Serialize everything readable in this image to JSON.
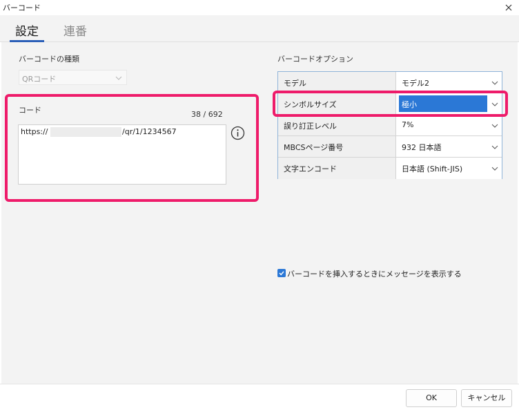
{
  "window": {
    "title": "バーコード"
  },
  "tabs": [
    {
      "label": "設定",
      "active": true
    },
    {
      "label": "連番",
      "active": false
    }
  ],
  "left": {
    "type_label": "バーコードの種類",
    "type_value": "QRコード",
    "code_label": "コード",
    "code_count": "38 / 692",
    "code_prefix": "https://",
    "code_suffix": "/qr/1/1234567"
  },
  "options": {
    "label": "バーコードオプション",
    "rows": [
      {
        "key": "モデル",
        "value": "モデル2"
      },
      {
        "key": "シンボルサイズ",
        "value": "極小"
      },
      {
        "key": "誤り訂正レベル",
        "value": "7%"
      },
      {
        "key": "MBCSページ番号",
        "value": "932 日本語"
      },
      {
        "key": "文字エンコード",
        "value": "日本語 (Shift-JIS)"
      }
    ]
  },
  "checkbox": {
    "label": "バーコードを挿入するときにメッセージを表示する",
    "checked": true
  },
  "buttons": {
    "ok": "OK",
    "cancel": "キャンセル"
  },
  "colors": {
    "highlight": "#ee1b6a",
    "selection": "#2b78d6",
    "tab_accent": "#2b5fb8"
  }
}
